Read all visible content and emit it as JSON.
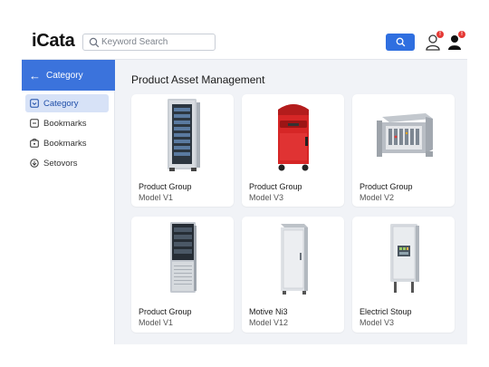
{
  "header": {
    "logo": "iCata",
    "search_placeholder": "Keyword Search",
    "user_badge": "!",
    "account_badge": "!"
  },
  "sidebar": {
    "back_label": "Category",
    "items": [
      {
        "label": "Category",
        "icon": "category-icon",
        "active": true
      },
      {
        "label": "Bookmarks",
        "icon": "bookmark-icon",
        "active": false
      },
      {
        "label": "Bookmarks",
        "icon": "lock-icon",
        "active": false
      },
      {
        "label": "Setovors",
        "icon": "settings-icon",
        "active": false
      }
    ]
  },
  "main": {
    "title": "Product Asset Management",
    "cards": [
      {
        "name": "Product Group",
        "model": "Model V1",
        "image": "server-rack-icon"
      },
      {
        "name": "Product Group",
        "model": "Model V3",
        "image": "red-cabinet-icon"
      },
      {
        "name": "Product Group",
        "model": "Model V2",
        "image": "open-chassis-icon"
      },
      {
        "name": "Product Group",
        "model": "Model V1",
        "image": "tower-server-icon"
      },
      {
        "name": "Motive Ni3",
        "model": "Model V12",
        "image": "grey-cabinet-icon"
      },
      {
        "name": "Electricl Stoup",
        "model": "Model V3",
        "image": "electrical-panel-icon"
      }
    ]
  },
  "colors": {
    "accent": "#2f6fe0",
    "sidebar_header": "#3b73dc",
    "active_item_bg": "#d7e2f7",
    "badge": "#e53935"
  }
}
